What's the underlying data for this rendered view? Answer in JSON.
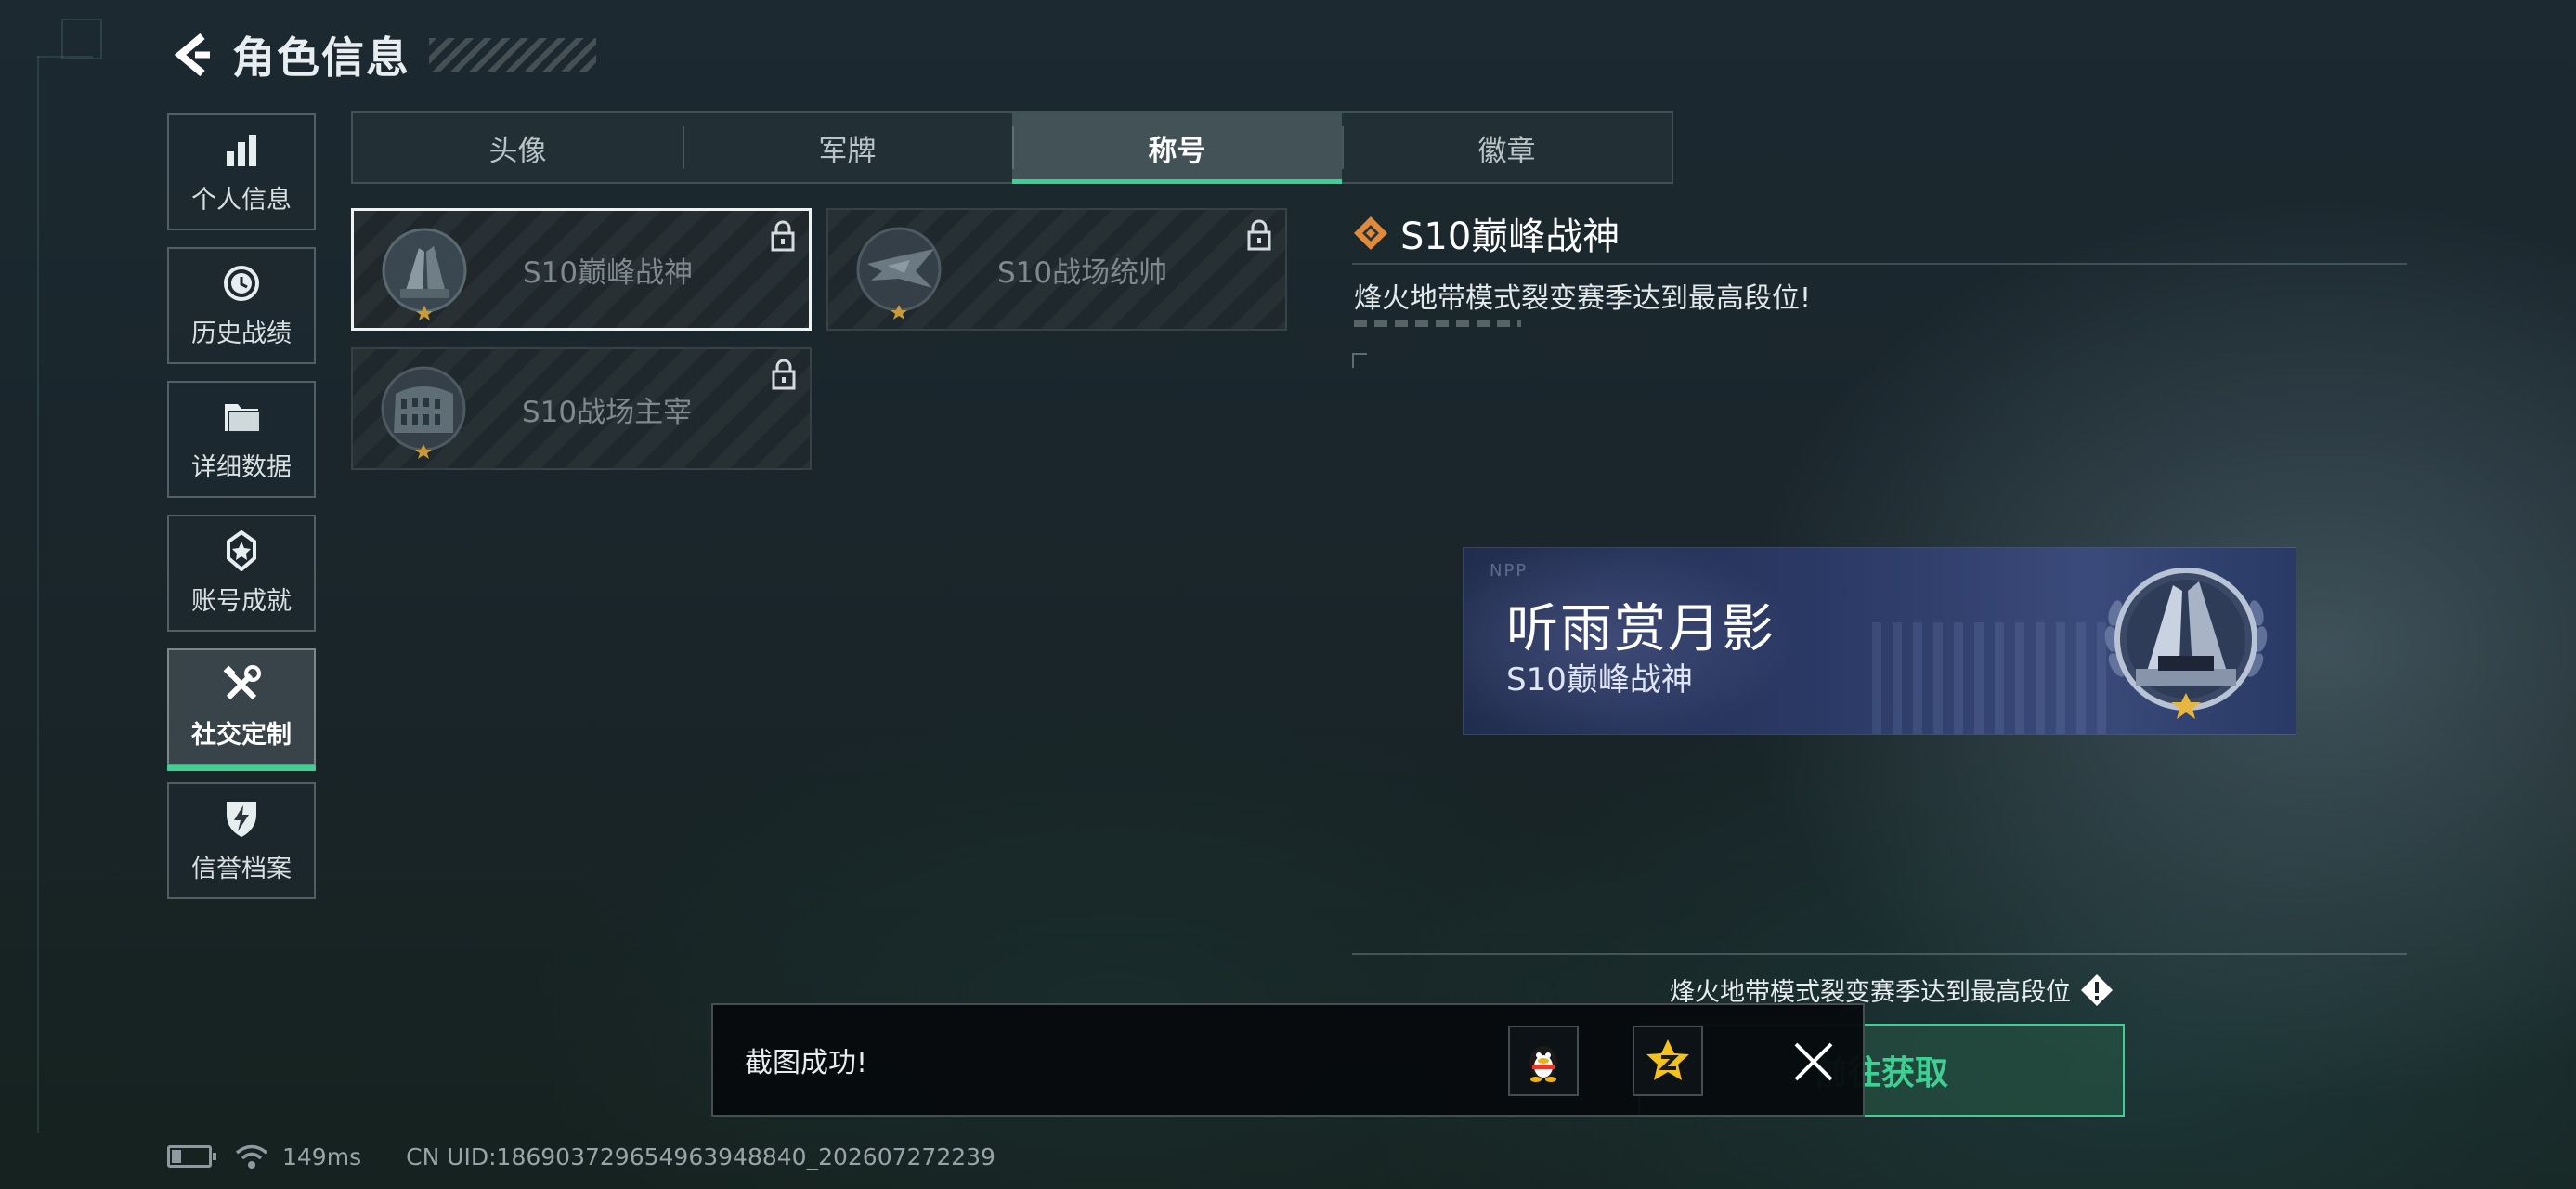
{
  "header": {
    "title": "角色信息"
  },
  "sidebar": {
    "items": [
      {
        "label": "个人信息",
        "icon": "bar-chart-icon"
      },
      {
        "label": "历史战绩",
        "icon": "history-clock-icon"
      },
      {
        "label": "详细数据",
        "icon": "folder-icon"
      },
      {
        "label": "账号成就",
        "icon": "medal-icon"
      },
      {
        "label": "社交定制",
        "icon": "tools-icon",
        "active": true
      },
      {
        "label": "信誉档案",
        "icon": "shield-lightning-icon"
      }
    ]
  },
  "tabs": [
    {
      "label": "头像"
    },
    {
      "label": "军牌"
    },
    {
      "label": "称号",
      "active": true
    },
    {
      "label": "徽章"
    }
  ],
  "titles": [
    {
      "label": "S10巅峰战神",
      "locked": true,
      "selected": true
    },
    {
      "label": "S10战场统帅",
      "locked": true
    },
    {
      "label": "S10战场主宰",
      "locked": true
    }
  ],
  "detail": {
    "title": "S10巅峰战神",
    "description": "烽火地带模式裂变赛季达到最高段位!"
  },
  "nameplate": {
    "logo": "NPP",
    "player_name": "听雨赏月影",
    "title": "S10巅峰战神"
  },
  "requirement": {
    "text": "烽火地带模式裂变赛季达到最高段位"
  },
  "go_button": {
    "label": "前往获取"
  },
  "toast": {
    "text": "截图成功!"
  },
  "status": {
    "ping": "149ms",
    "uid": "CN UID:186903729654963948840_202607272239"
  },
  "colors": {
    "accent": "#3ecf93",
    "diamond": "#e08a3c"
  }
}
